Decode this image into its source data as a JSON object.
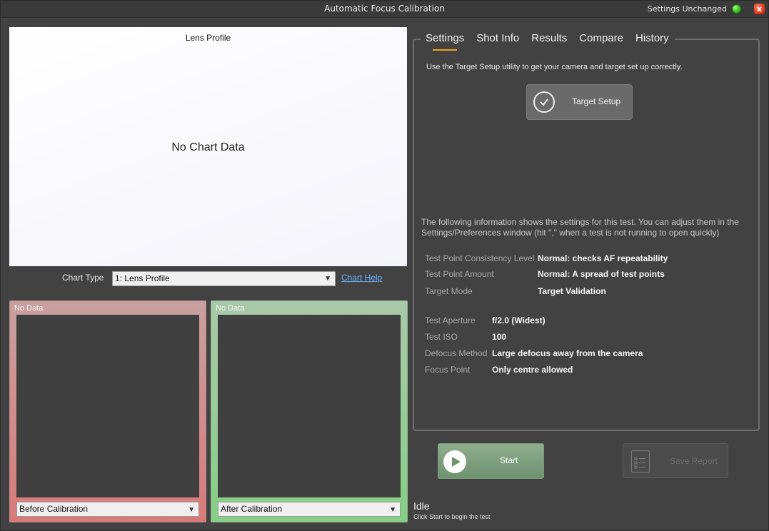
{
  "window": {
    "title": "Automatic Focus Calibration",
    "status_text": "Settings Unchanged",
    "status_color": "#3fcf1d",
    "close_glyph": "x"
  },
  "chart": {
    "title": "Lens Profile",
    "empty_message": "No Chart Data",
    "type_label": "Chart Type",
    "type_selected": "1: Lens Profile",
    "help_link": "Chart Help"
  },
  "panels": {
    "before": {
      "status": "No Data",
      "selected": "Before Calibration",
      "color": "#c99d9d"
    },
    "after": {
      "status": "No Data",
      "selected": "After Calibration",
      "color": "#86cf86"
    }
  },
  "tabs": [
    "Settings",
    "Shot Info",
    "Results",
    "Compare",
    "History"
  ],
  "active_tab": "Settings",
  "settings": {
    "hint": "Use the Target Setup utility to get your camera and target set up correctly.",
    "target_button": "Target Setup",
    "info_text": "The following information shows the settings for this test. You can adjust them in the Settings/Preferences window (hit \",\" when a test is not running to open quickly)",
    "rows1": [
      {
        "key": "Test Point Consistency Level",
        "value": "Normal: checks AF repeatability"
      },
      {
        "key": "Test Point Amount",
        "value": "Normal: A spread of test points"
      },
      {
        "key": "Target Mode",
        "value": "Target Validation"
      }
    ],
    "rows2": [
      {
        "key": "Test Aperture",
        "value": "f/2.0 (Widest)"
      },
      {
        "key": "Test ISO",
        "value": "100"
      },
      {
        "key": "Defocus Method",
        "value": "Large defocus away from the camera"
      },
      {
        "key": "Focus Point",
        "value": "Only centre allowed"
      }
    ]
  },
  "actions": {
    "start": "Start",
    "save_report": "Save Report"
  },
  "status": {
    "state": "Idle",
    "message": "Click Start to begin the test"
  },
  "colors": {
    "accent": "#f0a020",
    "link": "#6ab0ff"
  }
}
